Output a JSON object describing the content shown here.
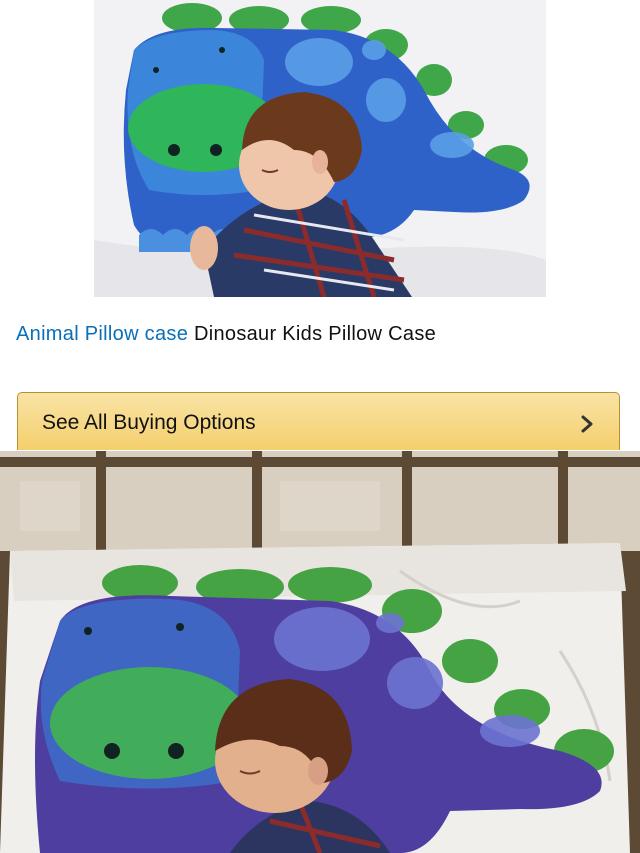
{
  "product": {
    "link_text": "Animal Pillow case",
    "title": "Dinosaur Kids Pillow Case",
    "photo_icon": "product-photo-icon"
  },
  "buy_button": {
    "label": "See All Buying Options",
    "icon": "chevron-right-icon"
  },
  "received": {
    "photo_icon": "received-photo-icon"
  },
  "colors": {
    "link": "#0a6fb8",
    "button_top": "#f9e3a6",
    "button_bottom": "#f4cf6c",
    "button_border": "#b79030"
  }
}
